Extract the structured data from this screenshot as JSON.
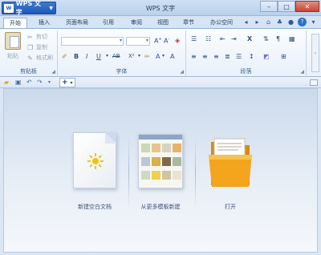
{
  "titlebar": {
    "app_button": "WPS 文字",
    "app_logo": "W",
    "window_title": "WPS 文字"
  },
  "tabs": [
    "开始",
    "插入",
    "页面布局",
    "引用",
    "审阅",
    "视图",
    "章节",
    "办公空间"
  ],
  "ribbon": {
    "clipboard": {
      "paste": "粘贴",
      "cut": "剪切",
      "copy": "复制",
      "format_painter": "格式刷",
      "label": "剪贴板"
    },
    "font": {
      "label": "字体"
    },
    "paragraph": {
      "label": "段落"
    }
  },
  "start_page": {
    "new_blank": "新建空白文档",
    "from_template": "从更多模板新建",
    "open": "打开"
  },
  "colors": {
    "title_accent": "#1f57b3",
    "folder": "#f2a51d",
    "sun": "#f4c20d"
  }
}
